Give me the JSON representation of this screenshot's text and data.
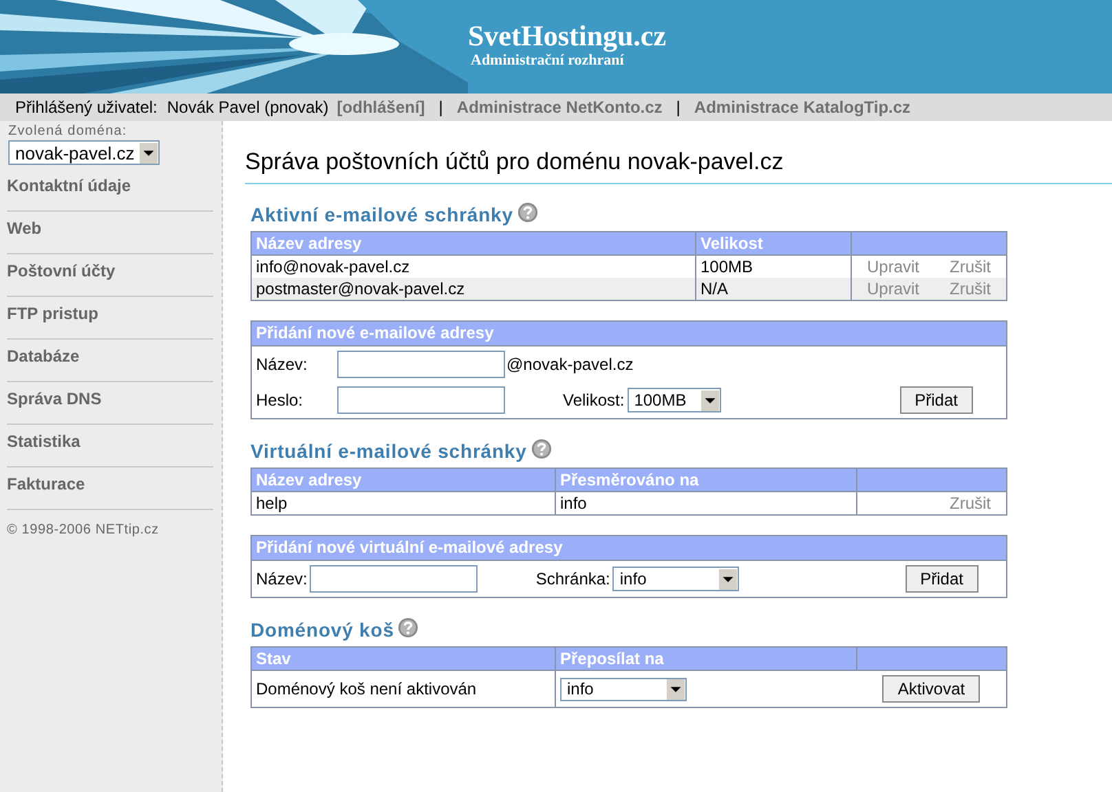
{
  "header": {
    "title": "SvetHostingu.cz",
    "subtitle": "Administrační rozhraní"
  },
  "user_bar": {
    "label": "Přihlášený uživatel:",
    "user": "Novák Pavel (pnovak)",
    "logout": "[odhlášení]",
    "links": [
      {
        "separator": "|",
        "label": "Administrace NetKonto.cz"
      },
      {
        "separator": "|",
        "label": "Administrace KatalogTip.cz"
      }
    ]
  },
  "sidebar": {
    "domain_label": "Zvolená doména:",
    "domain": "novak-pavel.cz",
    "items": [
      {
        "label": "Kontaktní údaje"
      },
      {
        "label": "Web"
      },
      {
        "label": "Poštovní účty"
      },
      {
        "label": "FTP pristup"
      },
      {
        "label": "Databáze"
      },
      {
        "label": "Správa DNS"
      },
      {
        "label": "Statistika"
      },
      {
        "label": "Fakturace"
      }
    ],
    "copyright": "© 1998-2006 NETtip.cz"
  },
  "main": {
    "title": "Správa poštovních účtů pro doménu novak-pavel.cz",
    "sections": [
      {
        "heading": "Aktivní e-mailové schránky",
        "table": {
          "columns": [
            "Název adresy",
            "Velikost"
          ],
          "rows": [
            {
              "kind": "actions",
              "cells": [
                "info@novak-pavel.cz",
                "100MB"
              ],
              "actions": [
                "Upravit",
                "Zrušit"
              ]
            },
            {
              "kind": "actions",
              "cells": [
                "postmaster@novak-pavel.cz",
                "N/A"
              ],
              "actions": [
                "Upravit",
                "Zrušit"
              ]
            }
          ]
        },
        "form": {
          "heading": "Přidání nové e-mailové adresy",
          "rows": [
            [
              {
                "kind": "label",
                "text": "Název:"
              },
              {
                "kind": "input"
              },
              {
                "kind": "text",
                "text": "@novak-pavel.cz"
              }
            ],
            [
              {
                "kind": "label",
                "text": "Heslo:"
              },
              {
                "kind": "input"
              },
              {
                "kind": "label2",
                "text": "Velikost:"
              },
              {
                "kind": "select",
                "value": "100MB"
              },
              {
                "kind": "button",
                "text": "Přidat"
              }
            ]
          ]
        }
      },
      {
        "heading": "Virtuální e-mailové schránky",
        "table": {
          "columns": [
            "Název adresy",
            "Přesměrováno na"
          ],
          "rows": [
            {
              "kind": "actions",
              "cells": [
                "help",
                "info"
              ],
              "actions": [
                "Zrušit"
              ]
            }
          ]
        },
        "form": {
          "heading": "Přidání nové virtuální e-mailové adresy",
          "rows": [
            [
              {
                "kind": "label",
                "text": "Název:"
              },
              {
                "kind": "input"
              },
              {
                "kind": "label2",
                "text": "Schránka:"
              },
              {
                "kind": "select",
                "value": "info"
              },
              {
                "kind": "button",
                "text": "Přidat"
              }
            ]
          ]
        }
      },
      {
        "heading": "Doménový koš",
        "table": {
          "columns": [
            "Stav",
            "Přeposílat na"
          ],
          "rows": [
            {
              "kind": "control",
              "cells": [
                "Doménový koš není aktivován"
              ],
              "select": "info",
              "button": "Aktivovat"
            }
          ]
        }
      }
    ]
  }
}
